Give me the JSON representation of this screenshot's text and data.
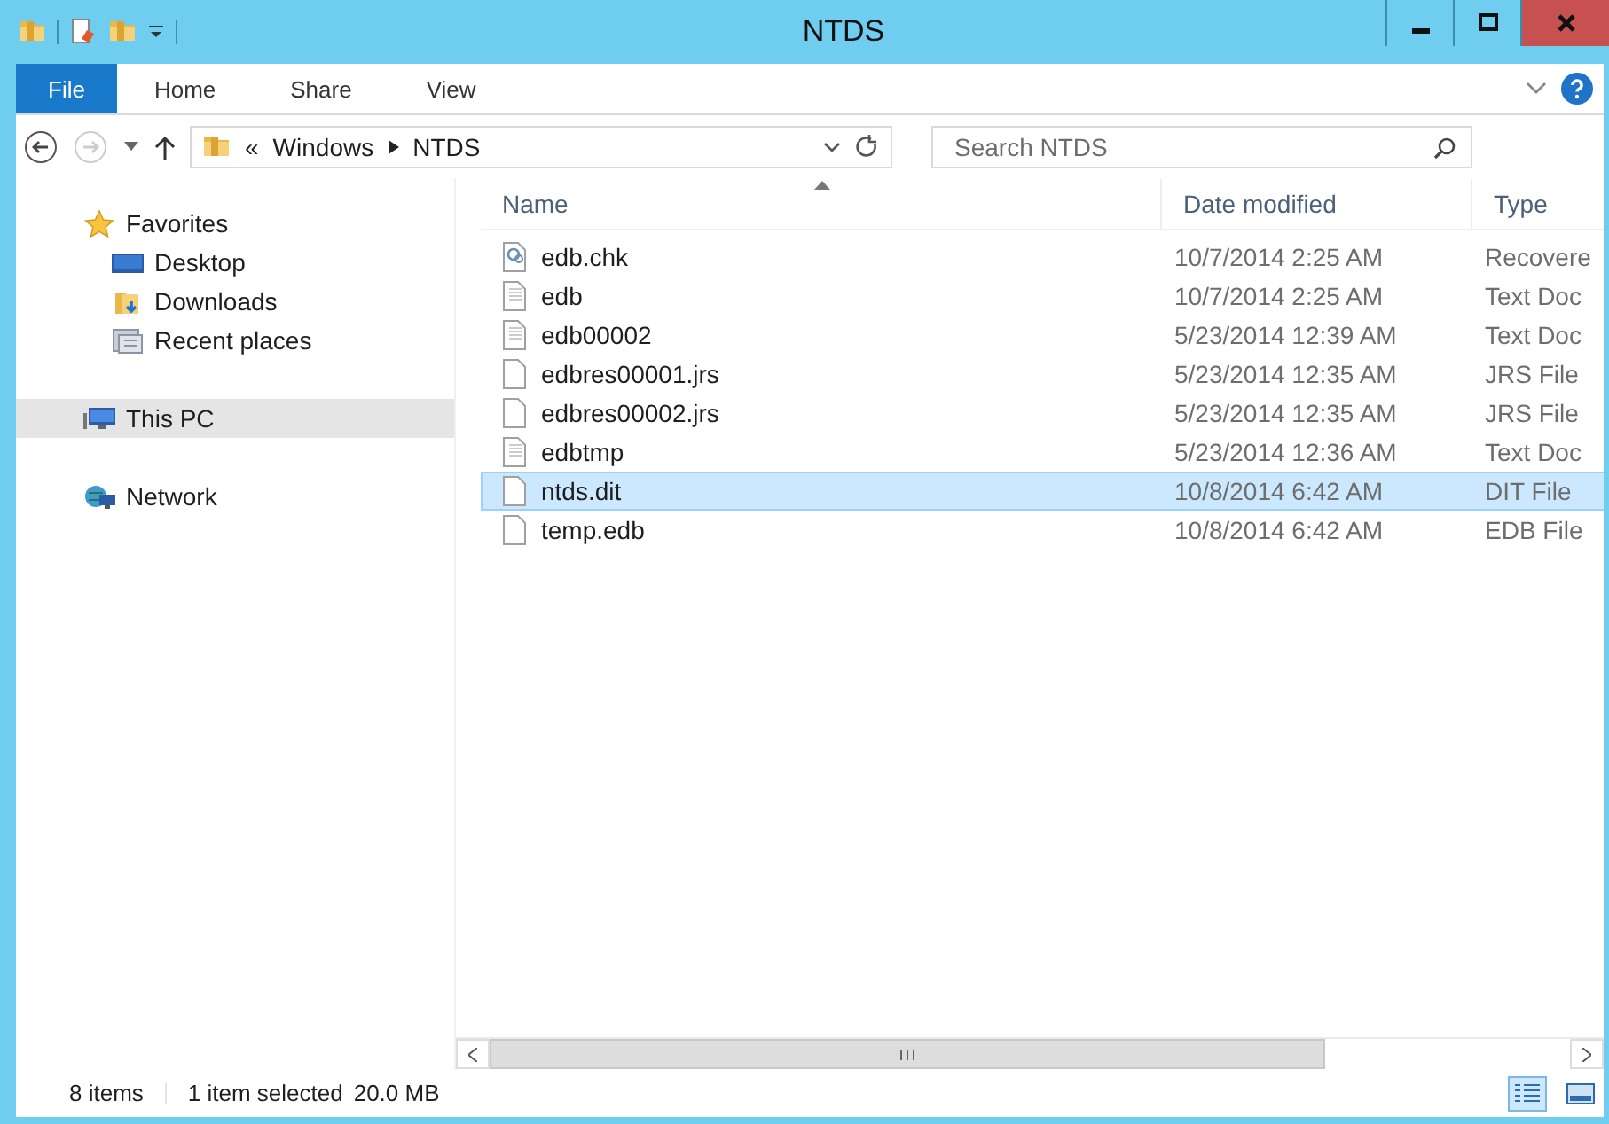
{
  "window": {
    "title": "NTDS"
  },
  "ribbon": {
    "tabs": [
      {
        "label": "File",
        "selected": true
      },
      {
        "label": "Home",
        "selected": false
      },
      {
        "label": "Share",
        "selected": false
      },
      {
        "label": "View",
        "selected": false
      }
    ]
  },
  "address": {
    "overflow": "«",
    "parts": [
      "Windows",
      "NTDS"
    ]
  },
  "search": {
    "placeholder": "Search NTDS"
  },
  "sidebar": {
    "items": [
      {
        "label": "Favorites",
        "kind": "favorites",
        "selected": false,
        "children": [
          {
            "label": "Desktop",
            "kind": "desktop",
            "selected": false
          },
          {
            "label": "Downloads",
            "kind": "downloads",
            "selected": false
          },
          {
            "label": "Recent places",
            "kind": "recent",
            "selected": false
          }
        ]
      },
      {
        "label": "This PC",
        "kind": "pc",
        "selected": true
      },
      {
        "label": "Network",
        "kind": "network",
        "selected": false
      }
    ]
  },
  "table": {
    "columns": [
      {
        "label": "Name",
        "sorted": true
      },
      {
        "label": "Date modified",
        "sorted": false
      },
      {
        "label": "Type",
        "sorted": false
      }
    ],
    "rows": [
      {
        "name": "edb.chk",
        "date": "10/7/2014 2:25 AM",
        "type": "Recovere",
        "kind": "gear",
        "selected": false
      },
      {
        "name": "edb",
        "date": "10/7/2014 2:25 AM",
        "type": "Text Doc",
        "kind": "text",
        "selected": false
      },
      {
        "name": "edb00002",
        "date": "5/23/2014 12:39 AM",
        "type": "Text Doc",
        "kind": "text",
        "selected": false
      },
      {
        "name": "edbres00001.jrs",
        "date": "5/23/2014 12:35 AM",
        "type": "JRS File",
        "kind": "blank",
        "selected": false
      },
      {
        "name": "edbres00002.jrs",
        "date": "5/23/2014 12:35 AM",
        "type": "JRS File",
        "kind": "blank",
        "selected": false
      },
      {
        "name": "edbtmp",
        "date": "5/23/2014 12:36 AM",
        "type": "Text Doc",
        "kind": "text",
        "selected": false
      },
      {
        "name": "ntds.dit",
        "date": "10/8/2014 6:42 AM",
        "type": "DIT File",
        "kind": "blank",
        "selected": true
      },
      {
        "name": "temp.edb",
        "date": "10/8/2014 6:42 AM",
        "type": "EDB File",
        "kind": "blank",
        "selected": false
      }
    ]
  },
  "status_bar": {
    "count": "8 items",
    "selection": "1 item selected",
    "size": "20.0 MB",
    "views": [
      {
        "kind": "details",
        "selected": true
      },
      {
        "kind": "tiles",
        "selected": false
      }
    ]
  }
}
